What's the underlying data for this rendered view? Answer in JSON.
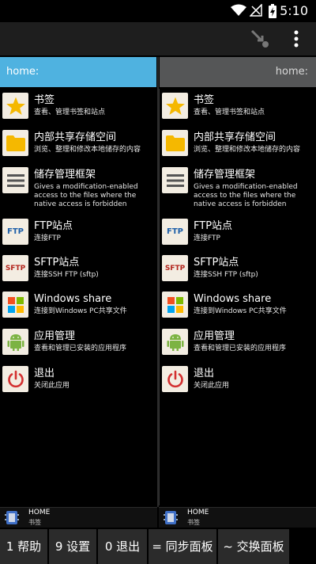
{
  "status": {
    "time": "5:10"
  },
  "left_pane": {
    "header": "home:",
    "items": [
      {
        "title": "书签",
        "sub": "查看、管理书签和站点",
        "icon": "star-icon"
      },
      {
        "title": "内部共享存储空间",
        "sub": "浏览、整理和修改本地储存的内容",
        "icon": "folder-icon"
      },
      {
        "title": "储存管理框架",
        "sub": "Gives a modification-enabled access to the files where the native access is forbidden",
        "icon": "hamburger-icon"
      },
      {
        "title": "FTP站点",
        "sub": "连接FTP",
        "icon": "ftp-icon",
        "icon_text": "FTP"
      },
      {
        "title": "SFTP站点",
        "sub": "连接SSH FTP (sftp)",
        "icon": "sftp-icon",
        "icon_text": "SFTP"
      },
      {
        "title": "Windows share",
        "sub": "连接到Windows PC共享文件",
        "icon": "windows-icon"
      },
      {
        "title": "应用管理",
        "sub": "查看和管理已安装的应用程序",
        "icon": "android-icon"
      },
      {
        "title": "退出",
        "sub": "关闭此应用",
        "icon": "power-icon"
      }
    ],
    "bottom": {
      "title": "HOME",
      "sub": "书签"
    }
  },
  "right_pane": {
    "header": "home:",
    "items": [
      {
        "title": "书签",
        "sub": "查看、管理书签和站点",
        "icon": "star-icon"
      },
      {
        "title": "内部共享存储空间",
        "sub": "浏览、整理和修改本地储存的内容",
        "icon": "folder-icon"
      },
      {
        "title": "储存管理框架",
        "sub": "Gives a modification-enabled access to the files where the native access is forbidden",
        "icon": "hamburger-icon"
      },
      {
        "title": "FTP站点",
        "sub": "连接FTP",
        "icon": "ftp-icon",
        "icon_text": "FTP"
      },
      {
        "title": "SFTP站点",
        "sub": "连接SSH FTP (sftp)",
        "icon": "sftp-icon",
        "icon_text": "SFTP"
      },
      {
        "title": "Windows share",
        "sub": "连接到Windows PC共享文件",
        "icon": "windows-icon"
      },
      {
        "title": "应用管理",
        "sub": "查看和管理已安装的应用程序",
        "icon": "android-icon"
      },
      {
        "title": "退出",
        "sub": "关闭此应用",
        "icon": "power-icon"
      }
    ],
    "bottom": {
      "title": "HOME",
      "sub": "书签"
    }
  },
  "fkeys": [
    {
      "label": "1 帮助"
    },
    {
      "label": "9 设置"
    },
    {
      "label": "0 退出"
    },
    {
      "label": "= 同步面板"
    },
    {
      "label": "~ 交换面板"
    }
  ],
  "colors": {
    "active_header": "#4fb2e0",
    "inactive_header": "#555657",
    "key_bg": "#2b2b2b"
  }
}
